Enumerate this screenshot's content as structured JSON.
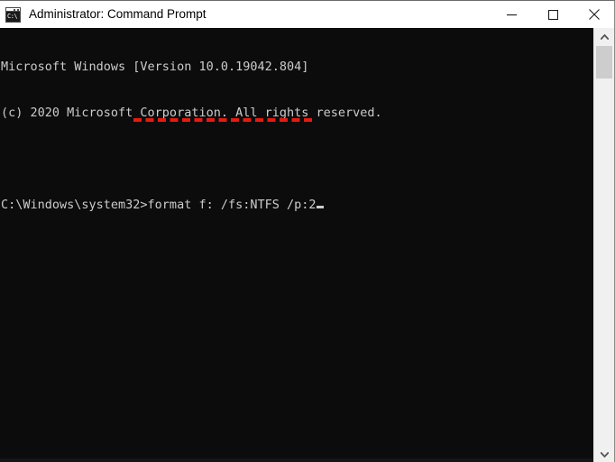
{
  "window": {
    "title": "Administrator: Command Prompt",
    "app_icon": "command-prompt-icon",
    "icon_glyph": "C:\\",
    "background_color": "#0c0c0c",
    "titlebar_color": "#ffffff",
    "text_color": "#cccccc"
  },
  "titlebar_controls": {
    "minimize_label": "Minimize",
    "maximize_label": "Maximize",
    "close_label": "Close"
  },
  "console": {
    "lines": [
      "Microsoft Windows [Version 10.0.19042.804]",
      "(c) 2020 Microsoft Corporation. All rights reserved.",
      "",
      "C:\\Windows\\system32>format f: /fs:NTFS /p:2"
    ],
    "prompt": "C:\\Windows\\system32>",
    "command": "format f: /fs:NTFS /p:2",
    "cursor": "block-cursor"
  },
  "annotation": {
    "type": "red-dashed-underline",
    "color": "#e8190f",
    "underlines_text": "format f: /fs:NTFS /p:2"
  },
  "scrollbar": {
    "up_arrow": "chevron-up-icon",
    "down_arrow": "chevron-down-icon",
    "thumb_color": "#cdcdcd",
    "track_color": "#f0f0f0"
  }
}
